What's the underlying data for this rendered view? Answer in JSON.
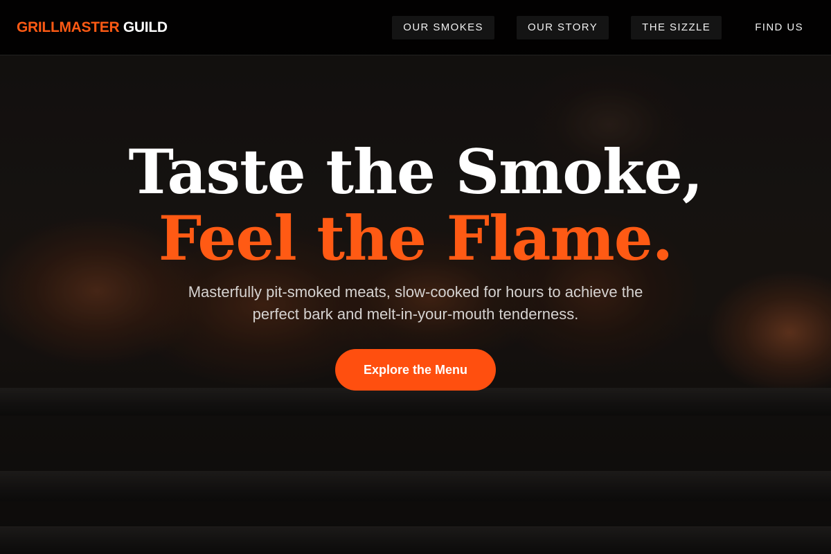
{
  "brand": {
    "accent_text": "GRILLMASTER",
    "rest_text": " GUILD"
  },
  "nav": {
    "items": [
      {
        "label": "OUR SMOKES"
      },
      {
        "label": "OUR STORY"
      },
      {
        "label": "THE SIZZLE"
      },
      {
        "label": "FIND US"
      }
    ]
  },
  "hero": {
    "headline_line1": "Taste the Smoke,",
    "headline_line2": "Feel the Flame.",
    "subtext": "Masterfully pit-smoked meats, slow-cooked for hours to achieve the perfect bark and melt-in-your-mouth tenderness.",
    "cta_label": "Explore the Menu"
  },
  "colors": {
    "accent": "#ff5a14",
    "cta_background": "#ff4f0f",
    "nav_background": "#000000",
    "text_primary": "#ffffff",
    "text_secondary": "#d6d3d1"
  }
}
